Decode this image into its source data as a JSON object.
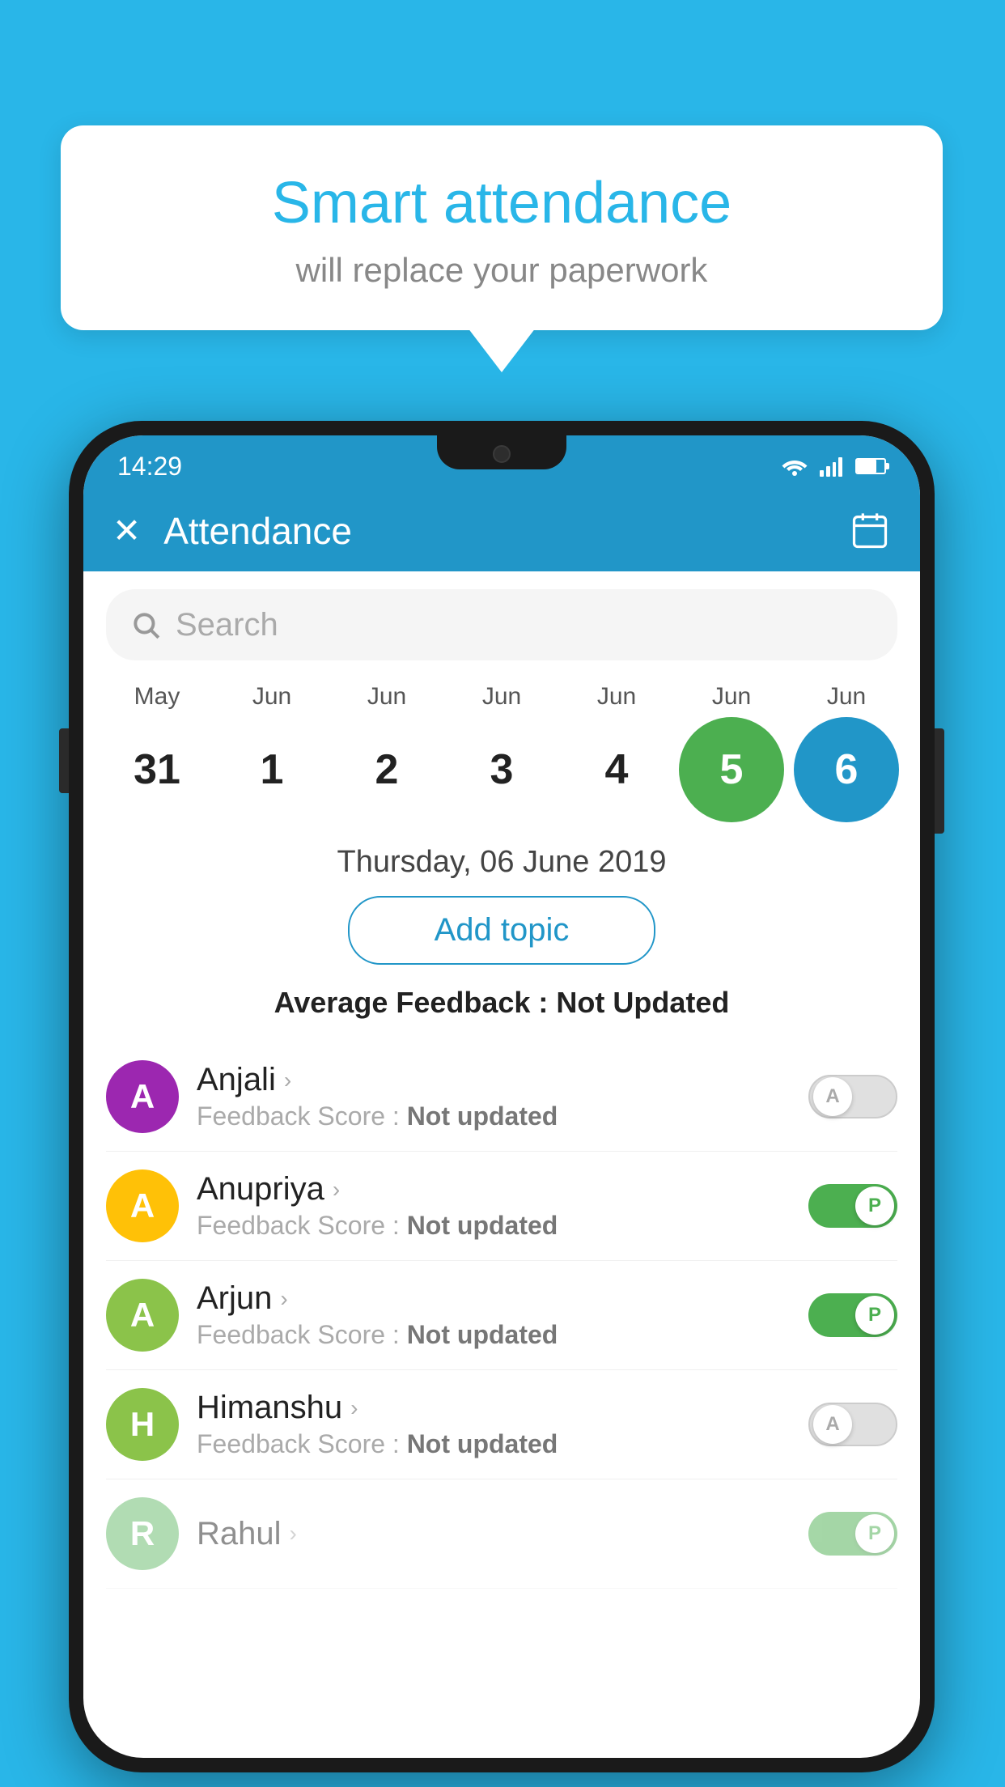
{
  "background_color": "#29b6e8",
  "bubble": {
    "title": "Smart attendance",
    "subtitle": "will replace your paperwork"
  },
  "status_bar": {
    "time": "14:29"
  },
  "app_bar": {
    "title": "Attendance"
  },
  "search": {
    "placeholder": "Search"
  },
  "calendar": {
    "months": [
      "May",
      "Jun",
      "Jun",
      "Jun",
      "Jun",
      "Jun",
      "Jun"
    ],
    "days": [
      "31",
      "1",
      "2",
      "3",
      "4",
      "5",
      "6"
    ],
    "states": [
      "normal",
      "normal",
      "normal",
      "normal",
      "normal",
      "today",
      "selected"
    ]
  },
  "selected_date": "Thursday, 06 June 2019",
  "add_topic": "Add topic",
  "avg_feedback_label": "Average Feedback : ",
  "avg_feedback_value": "Not Updated",
  "students": [
    {
      "name": "Anjali",
      "avatar_letter": "A",
      "avatar_color": "#9c27b0",
      "feedback_label": "Feedback Score : ",
      "feedback_value": "Not updated",
      "status": "absent"
    },
    {
      "name": "Anupriya",
      "avatar_letter": "A",
      "avatar_color": "#ffc107",
      "feedback_label": "Feedback Score : ",
      "feedback_value": "Not updated",
      "status": "present"
    },
    {
      "name": "Arjun",
      "avatar_letter": "A",
      "avatar_color": "#8bc34a",
      "feedback_label": "Feedback Score : ",
      "feedback_value": "Not updated",
      "status": "present"
    },
    {
      "name": "Himanshu",
      "avatar_letter": "H",
      "avatar_color": "#8bc34a",
      "feedback_label": "Feedback Score : ",
      "feedback_value": "Not updated",
      "status": "absent"
    }
  ]
}
